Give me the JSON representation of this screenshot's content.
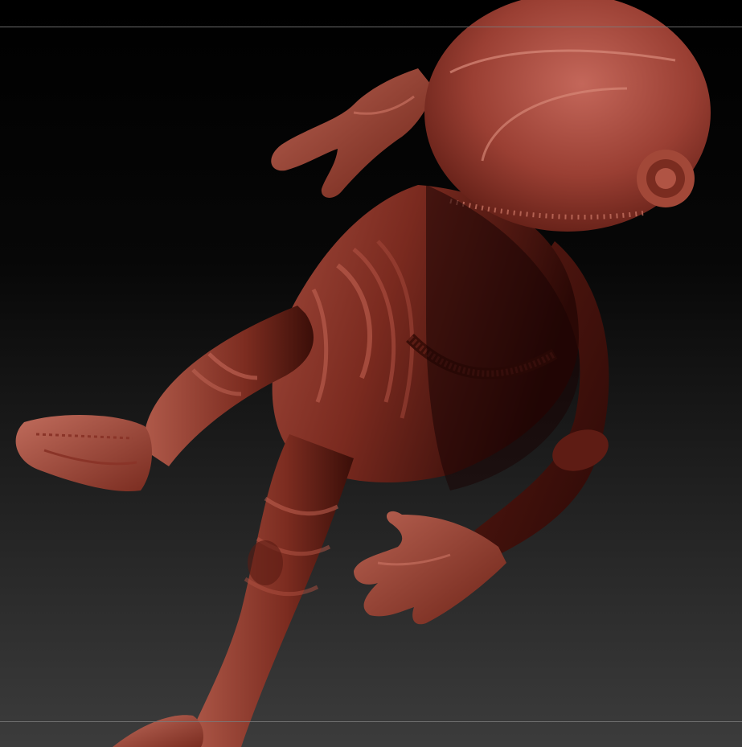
{
  "viewport": {
    "background_top": "#000000",
    "background_bottom": "#3a3a3a",
    "guide_line_color": "#7a7a7a"
  },
  "model": {
    "subject": "astronaut-sculpt",
    "material_base": "#8a3328",
    "material_highlight": "#c86a5a",
    "material_shadow": "#3a0d08"
  }
}
